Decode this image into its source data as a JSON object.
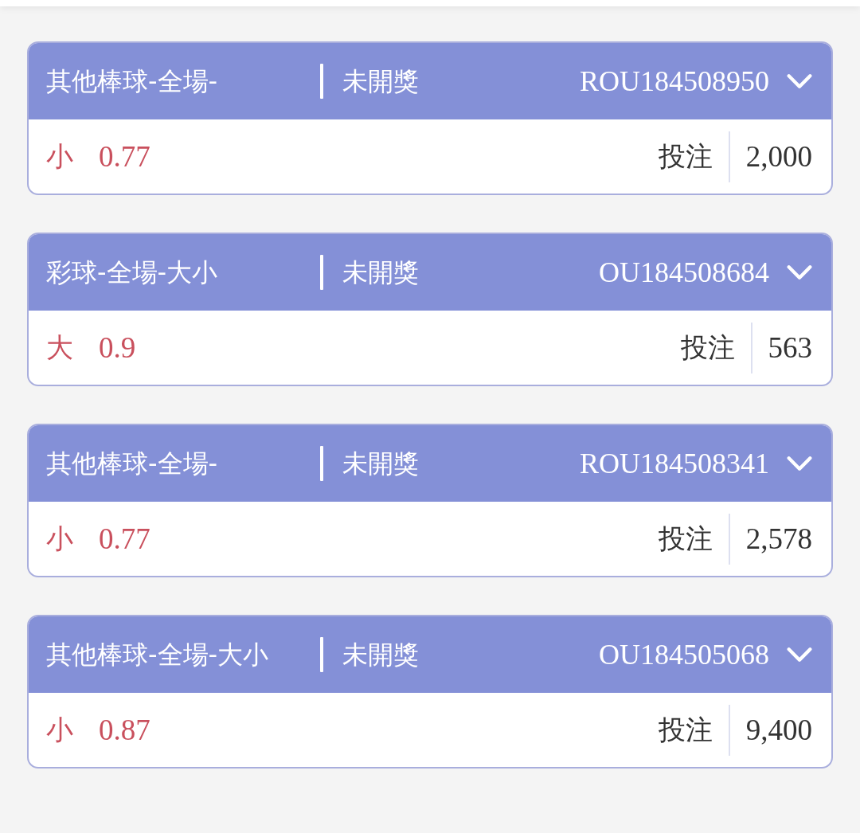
{
  "bets": [
    {
      "title": "其他棒球-全場-",
      "status": "未開獎",
      "bet_id": "ROU184508950",
      "expanded": false,
      "pick": "小",
      "odds": "0.77",
      "stake_label": "投注",
      "stake": "2,000"
    },
    {
      "title": "彩球-全場-大小",
      "status": "未開獎",
      "bet_id": "OU184508684",
      "expanded": false,
      "pick": "大",
      "odds": "0.9",
      "stake_label": "投注",
      "stake": "563"
    },
    {
      "title": "其他棒球-全場-",
      "status": "未開獎",
      "bet_id": "ROU184508341",
      "expanded": false,
      "pick": "小",
      "odds": "0.77",
      "stake_label": "投注",
      "stake": "2,578"
    },
    {
      "title": "其他棒球-全場-大小",
      "status": "未開獎",
      "bet_id": "OU184505068",
      "expanded": false,
      "pick": "小",
      "odds": "0.87",
      "stake_label": "投注",
      "stake": "9,400"
    }
  ]
}
